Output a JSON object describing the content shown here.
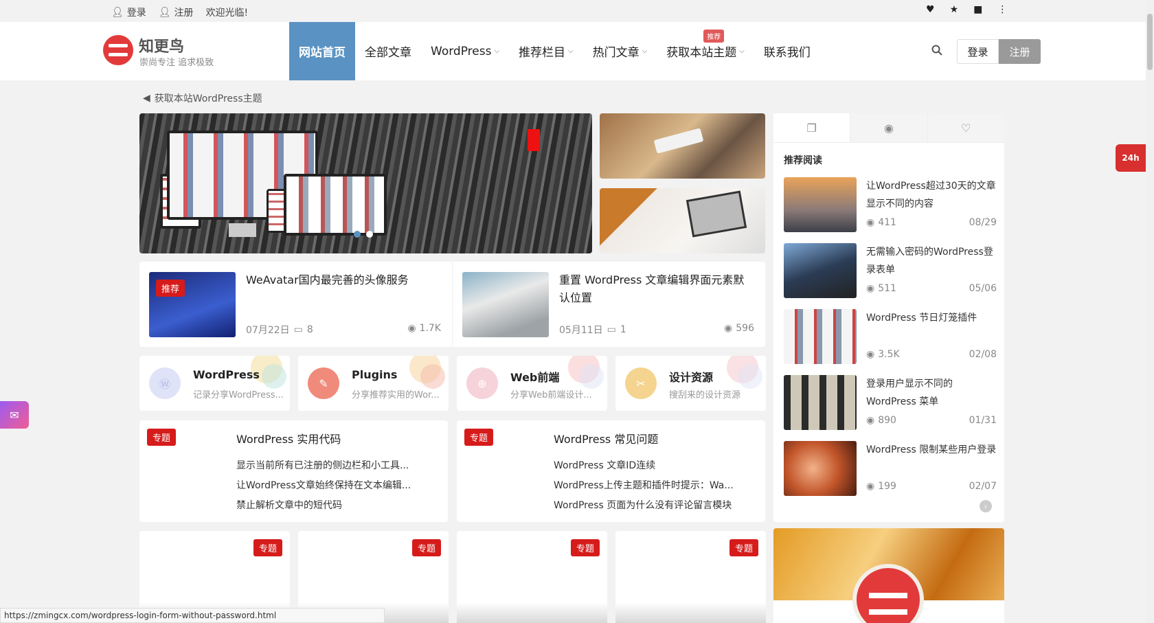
{
  "topbar": {
    "login": "登录",
    "register": "注册",
    "welcome": "欢迎光临!"
  },
  "brand": {
    "name": "知更鸟",
    "tagline": "崇尚专注 追求极致"
  },
  "nav": [
    {
      "label": "网站首页",
      "caret": false
    },
    {
      "label": "全部文章",
      "caret": false
    },
    {
      "label": "WordPress",
      "caret": true
    },
    {
      "label": "推荐栏目",
      "caret": true
    },
    {
      "label": "热门文章",
      "caret": true
    },
    {
      "label": "获取本站主题",
      "caret": true,
      "badge": "推荐"
    },
    {
      "label": "联系我们",
      "caret": false
    }
  ],
  "header_buttons": {
    "login": "登录",
    "register": "注册"
  },
  "notice": "获取本站WordPress主题",
  "posts": [
    {
      "tag": "推荐",
      "title": "WeAvatar国内最完善的头像服务",
      "date": "07月22日",
      "comments": "8",
      "views": "1.7K"
    },
    {
      "title": "重置 WordPress 文章编辑界面元素默认位置",
      "date": "05月11日",
      "comments": "1",
      "views": "596"
    }
  ],
  "categories": [
    {
      "name": "WordPress",
      "desc": "记录分享WordPress...",
      "color": "#aeb8e8"
    },
    {
      "name": "Plugins",
      "desc": "分享推荐实用的Wor...",
      "color": "#f08a7a"
    },
    {
      "name": "Web前端",
      "desc": "分享Web前端设计...",
      "color": "#f1b7c3"
    },
    {
      "name": "设计资源",
      "desc": "搜刮来的设计资源",
      "color": "#f3cd83"
    }
  ],
  "topics": [
    {
      "tag": "专题",
      "title": "WordPress 实用代码",
      "items": [
        "显示当前所有已注册的侧边栏和小工具...",
        "让WordPress文章始终保持在文本编辑...",
        "禁止解析文章中的短代码"
      ]
    },
    {
      "tag": "专题",
      "title": "WordPress 常见问题",
      "items": [
        "WordPress 文章ID连续",
        "WordPress上传主题和插件时提示：Wa...",
        "WordPress 页面为什么没有评论留言模块"
      ]
    }
  ],
  "stubs": [
    "专题",
    "专题",
    "专题",
    "专题"
  ],
  "sidebar": {
    "title": "推荐阅读",
    "items": [
      {
        "title": "让WordPress超过30天的文章显示不同的内容",
        "views": "411",
        "date": "08/29"
      },
      {
        "title": "无需输入密码的WordPress登录表单",
        "views": "511",
        "date": "05/06"
      },
      {
        "title": "WordPress 节日灯笼插件",
        "views": "3.5K",
        "date": "02/08"
      },
      {
        "title": "登录用户显示不同的 WordPress 菜单",
        "views": "890",
        "date": "01/31"
      },
      {
        "title": "WordPress 限制某些用户登录",
        "views": "199",
        "date": "02/07"
      }
    ]
  },
  "float_24": "24h",
  "statusbar": "https://zmingcx.com/wordpress-login-form-without-password.html",
  "colors": {
    "accent": "#5a93c3",
    "tag": "#d61b1b"
  }
}
